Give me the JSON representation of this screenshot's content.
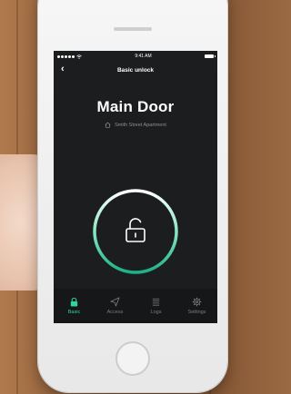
{
  "status_bar": {
    "time": "9:41 AM"
  },
  "nav": {
    "title": "Basic unlock",
    "back_icon": "chevron-left-icon"
  },
  "lock": {
    "name": "Main Door",
    "location": "Smith Street Apartment",
    "state_icon": "unlocked-padlock-icon",
    "ring_colors": [
      "#1db087",
      "#ffffff"
    ]
  },
  "tabs": [
    {
      "label": "Basic",
      "icon": "lock-icon",
      "active": true
    },
    {
      "label": "Access",
      "icon": "send-icon",
      "active": false
    },
    {
      "label": "Logs",
      "icon": "list-icon",
      "active": false
    },
    {
      "label": "Settings",
      "icon": "gear-icon",
      "active": false
    }
  ],
  "colors": {
    "accent": "#2fd59a",
    "screen_bg": "#1c1d1f"
  }
}
